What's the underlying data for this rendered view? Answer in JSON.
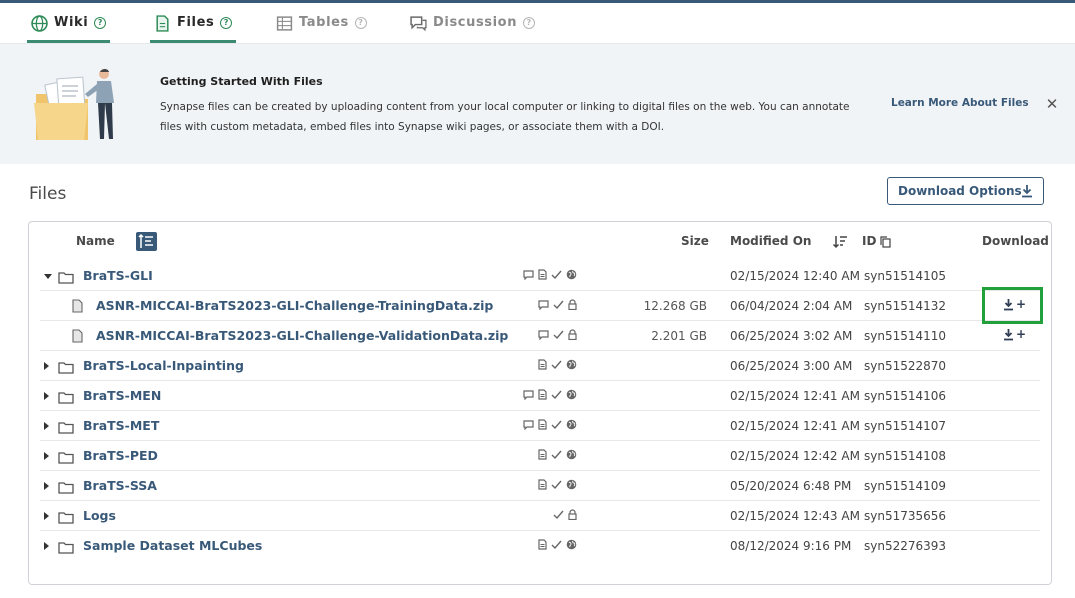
{
  "tabs": [
    {
      "label": "Wiki",
      "icon": "globe-icon",
      "active": true
    },
    {
      "label": "Files",
      "icon": "file-icon",
      "active": true
    },
    {
      "label": "Tables",
      "icon": "table-icon",
      "active": false
    },
    {
      "label": "Discussion",
      "icon": "chat-icon",
      "active": false
    }
  ],
  "help_glyph": "?",
  "banner": {
    "title": "Getting Started With Files",
    "body": "Synapse files can be created by uploading content from your local computer or linking to digital files on the web. You can annotate files with custom metadata, embed files into Synapse wiki pages, or associate them with a DOI.",
    "link": "Learn More About Files",
    "close": "✕"
  },
  "files": {
    "title": "Files",
    "download_options_label": "Download Options",
    "columns": {
      "name": "Name",
      "size": "Size",
      "modified": "Modified On",
      "id": "ID",
      "download": "Download"
    },
    "rows": [
      {
        "name": "BraTS-GLI",
        "type": "folder",
        "expanded": true,
        "size": "",
        "modified": "02/15/2024 12:40 AM",
        "id": "syn51514105",
        "badges": [
          "comment",
          "doc",
          "check",
          "globe"
        ],
        "download": ""
      },
      {
        "name": "ASNR-MICCAI-BraTS2023-GLI-Challenge-TrainingData.zip",
        "type": "file",
        "size": "12.268 GB",
        "modified": "06/04/2024 2:04 AM",
        "id": "syn51514132",
        "badges": [
          "comment",
          "check",
          "lock"
        ],
        "download": "+"
      },
      {
        "name": "ASNR-MICCAI-BraTS2023-GLI-Challenge-ValidationData.zip",
        "type": "file",
        "size": "2.201 GB",
        "modified": "06/25/2024 3:02 AM",
        "id": "syn51514110",
        "badges": [
          "comment",
          "check",
          "lock"
        ],
        "download": "+"
      },
      {
        "name": "BraTS-Local-Inpainting",
        "type": "folder",
        "expanded": false,
        "size": "",
        "modified": "06/25/2024 3:00 AM",
        "id": "syn51522870",
        "badges": [
          "doc",
          "check",
          "globe"
        ],
        "download": ""
      },
      {
        "name": "BraTS-MEN",
        "type": "folder",
        "expanded": false,
        "size": "",
        "modified": "02/15/2024 12:41 AM",
        "id": "syn51514106",
        "badges": [
          "comment",
          "doc",
          "check",
          "globe"
        ],
        "download": ""
      },
      {
        "name": "BraTS-MET",
        "type": "folder",
        "expanded": false,
        "size": "",
        "modified": "02/15/2024 12:41 AM",
        "id": "syn51514107",
        "badges": [
          "comment",
          "doc",
          "check",
          "globe"
        ],
        "download": ""
      },
      {
        "name": "BraTS-PED",
        "type": "folder",
        "expanded": false,
        "size": "",
        "modified": "02/15/2024 12:42 AM",
        "id": "syn51514108",
        "badges": [
          "doc",
          "check",
          "globe"
        ],
        "download": ""
      },
      {
        "name": "BraTS-SSA",
        "type": "folder",
        "expanded": false,
        "size": "",
        "modified": "05/20/2024 6:48 PM",
        "id": "syn51514109",
        "badges": [
          "doc",
          "check",
          "globe"
        ],
        "download": ""
      },
      {
        "name": "Logs",
        "type": "folder",
        "expanded": false,
        "size": "",
        "modified": "02/15/2024 12:43 AM",
        "id": "syn51735656",
        "badges": [
          "check",
          "lock"
        ],
        "download": ""
      },
      {
        "name": "Sample Dataset MLCubes",
        "type": "folder",
        "expanded": false,
        "size": "",
        "modified": "08/12/2024 9:16 PM",
        "id": "syn52276393",
        "badges": [
          "doc",
          "check",
          "globe"
        ],
        "download": ""
      }
    ]
  },
  "colors": {
    "brand": "#395979",
    "accent": "#3d8a73",
    "highlight": "#22a03b"
  }
}
